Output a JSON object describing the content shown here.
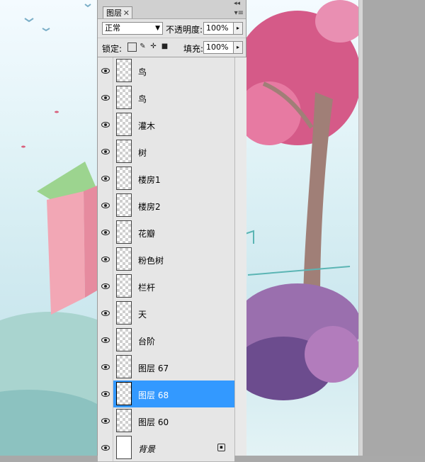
{
  "panel": {
    "tab_label": "图层",
    "close_glyph": "✕",
    "collapse_glyph": "◂◂",
    "menu_glyph": "▾≡",
    "blend_mode": "正常",
    "dropdown_glyph": "▼",
    "opacity_label": "不透明度:",
    "opacity_value": "100%",
    "lock_label": "锁定:",
    "fill_label": "填充:",
    "fill_value": "100%",
    "spin_glyph": "▸"
  },
  "layers": [
    {
      "name": "鸟",
      "visible": true
    },
    {
      "name": "鸟",
      "visible": true
    },
    {
      "name": "灌木",
      "visible": true
    },
    {
      "name": "树",
      "visible": true
    },
    {
      "name": "楼房1",
      "visible": true
    },
    {
      "name": "楼房2",
      "visible": true
    },
    {
      "name": "花瓣",
      "visible": true
    },
    {
      "name": "粉色树",
      "visible": true
    },
    {
      "name": "栏杆",
      "visible": true
    },
    {
      "name": "天",
      "visible": true
    },
    {
      "name": "台阶",
      "visible": true
    },
    {
      "name": "图层 67",
      "visible": true
    },
    {
      "name": "图层 68",
      "visible": true,
      "selected": true
    },
    {
      "name": "图层 60",
      "visible": true
    },
    {
      "name": "背景",
      "visible": true,
      "locked": true,
      "italic": true
    }
  ],
  "colors": {
    "selection": "#3399ff",
    "panel_bg": "#e4e4e4",
    "canvas_grey": "#a8a8a8"
  },
  "icons": {
    "eye": "eye-icon",
    "lock": "lock-icon"
  }
}
